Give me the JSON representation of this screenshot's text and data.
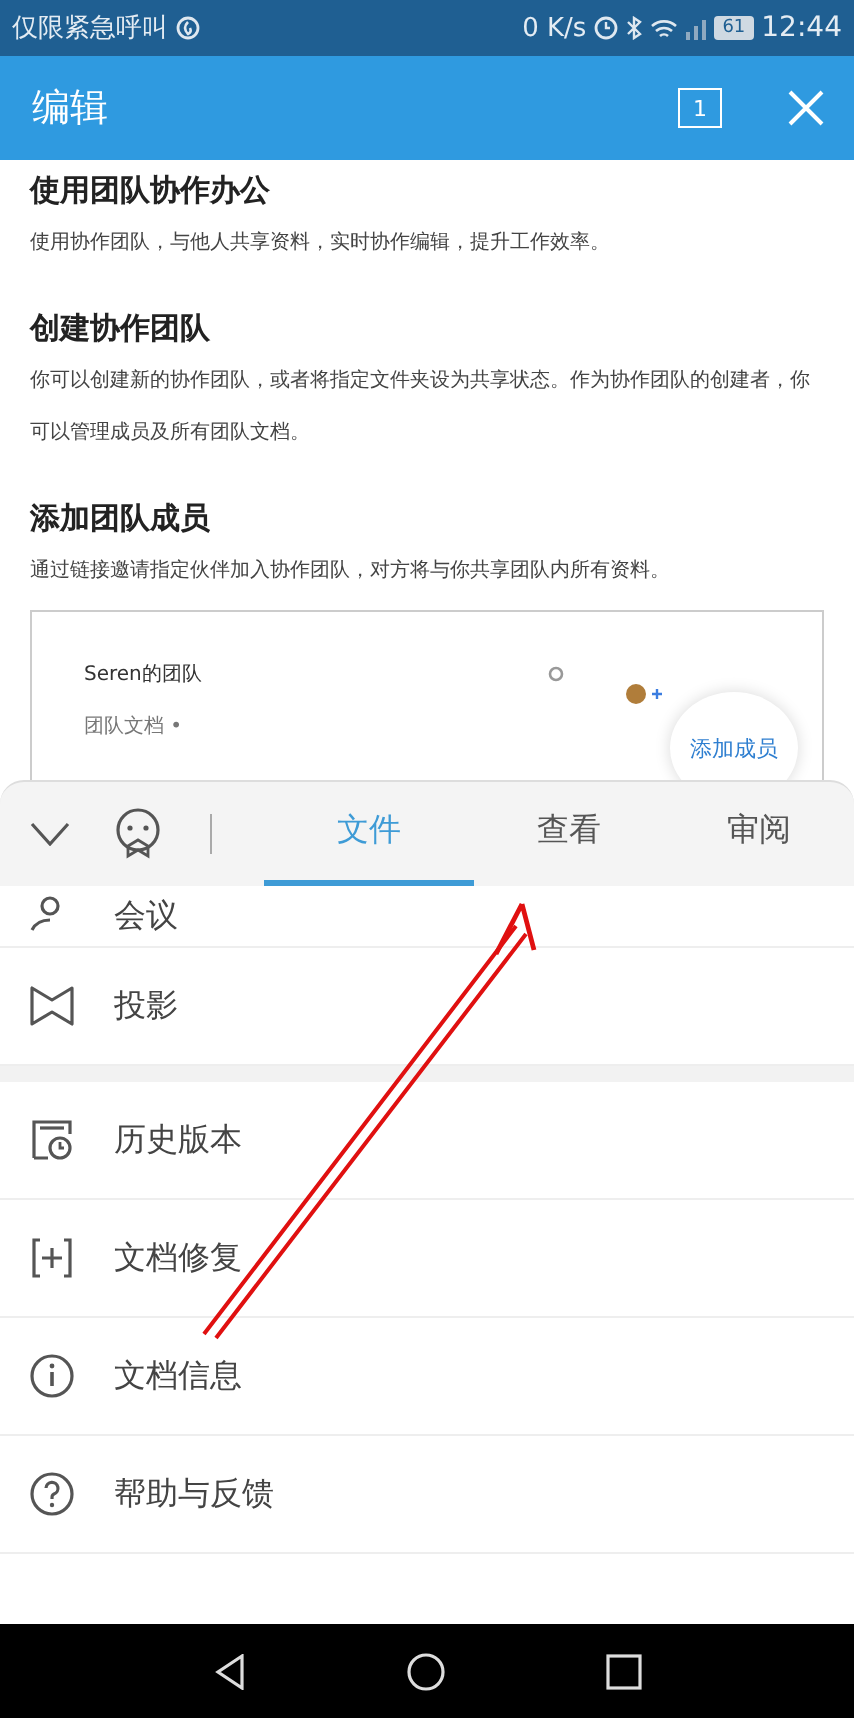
{
  "status_bar": {
    "carrier": "仅限紧急呼叫",
    "speed": "0 K/s",
    "battery": "61",
    "time": "12:44"
  },
  "header": {
    "title": "编辑",
    "page_count": "1"
  },
  "document": {
    "sections": [
      {
        "heading": "使用团队协作办公",
        "text": "使用协作团队，与他人共享资料，实时协作编辑，提升工作效率。"
      },
      {
        "heading": "创建协作团队",
        "text": "你可以创建新的协作团队，或者将指定文件夹设为共享状态。作为协作团队的创建者，你可以管理成员及所有团队文档。"
      },
      {
        "heading": "添加团队成员",
        "text": "通过链接邀请指定伙伴加入协作团队，对方将与你共享团队内所有资料。"
      }
    ],
    "embedded": {
      "team_name": "Seren的团队",
      "folder": "团队文档 •",
      "add_member": "添加成员"
    }
  },
  "toolbar": {
    "tabs": [
      {
        "label": "文件",
        "selected": true
      },
      {
        "label": "查看",
        "selected": false
      },
      {
        "label": "审阅",
        "selected": false
      }
    ]
  },
  "menu": {
    "groups": [
      [
        {
          "kind": "meeting",
          "label": "会议"
        },
        {
          "kind": "projection",
          "label": "投影"
        }
      ],
      [
        {
          "kind": "history",
          "label": "历史版本"
        },
        {
          "kind": "repair",
          "label": "文档修复"
        },
        {
          "kind": "info",
          "label": "文档信息"
        },
        {
          "kind": "help",
          "label": "帮助与反馈"
        }
      ]
    ]
  }
}
